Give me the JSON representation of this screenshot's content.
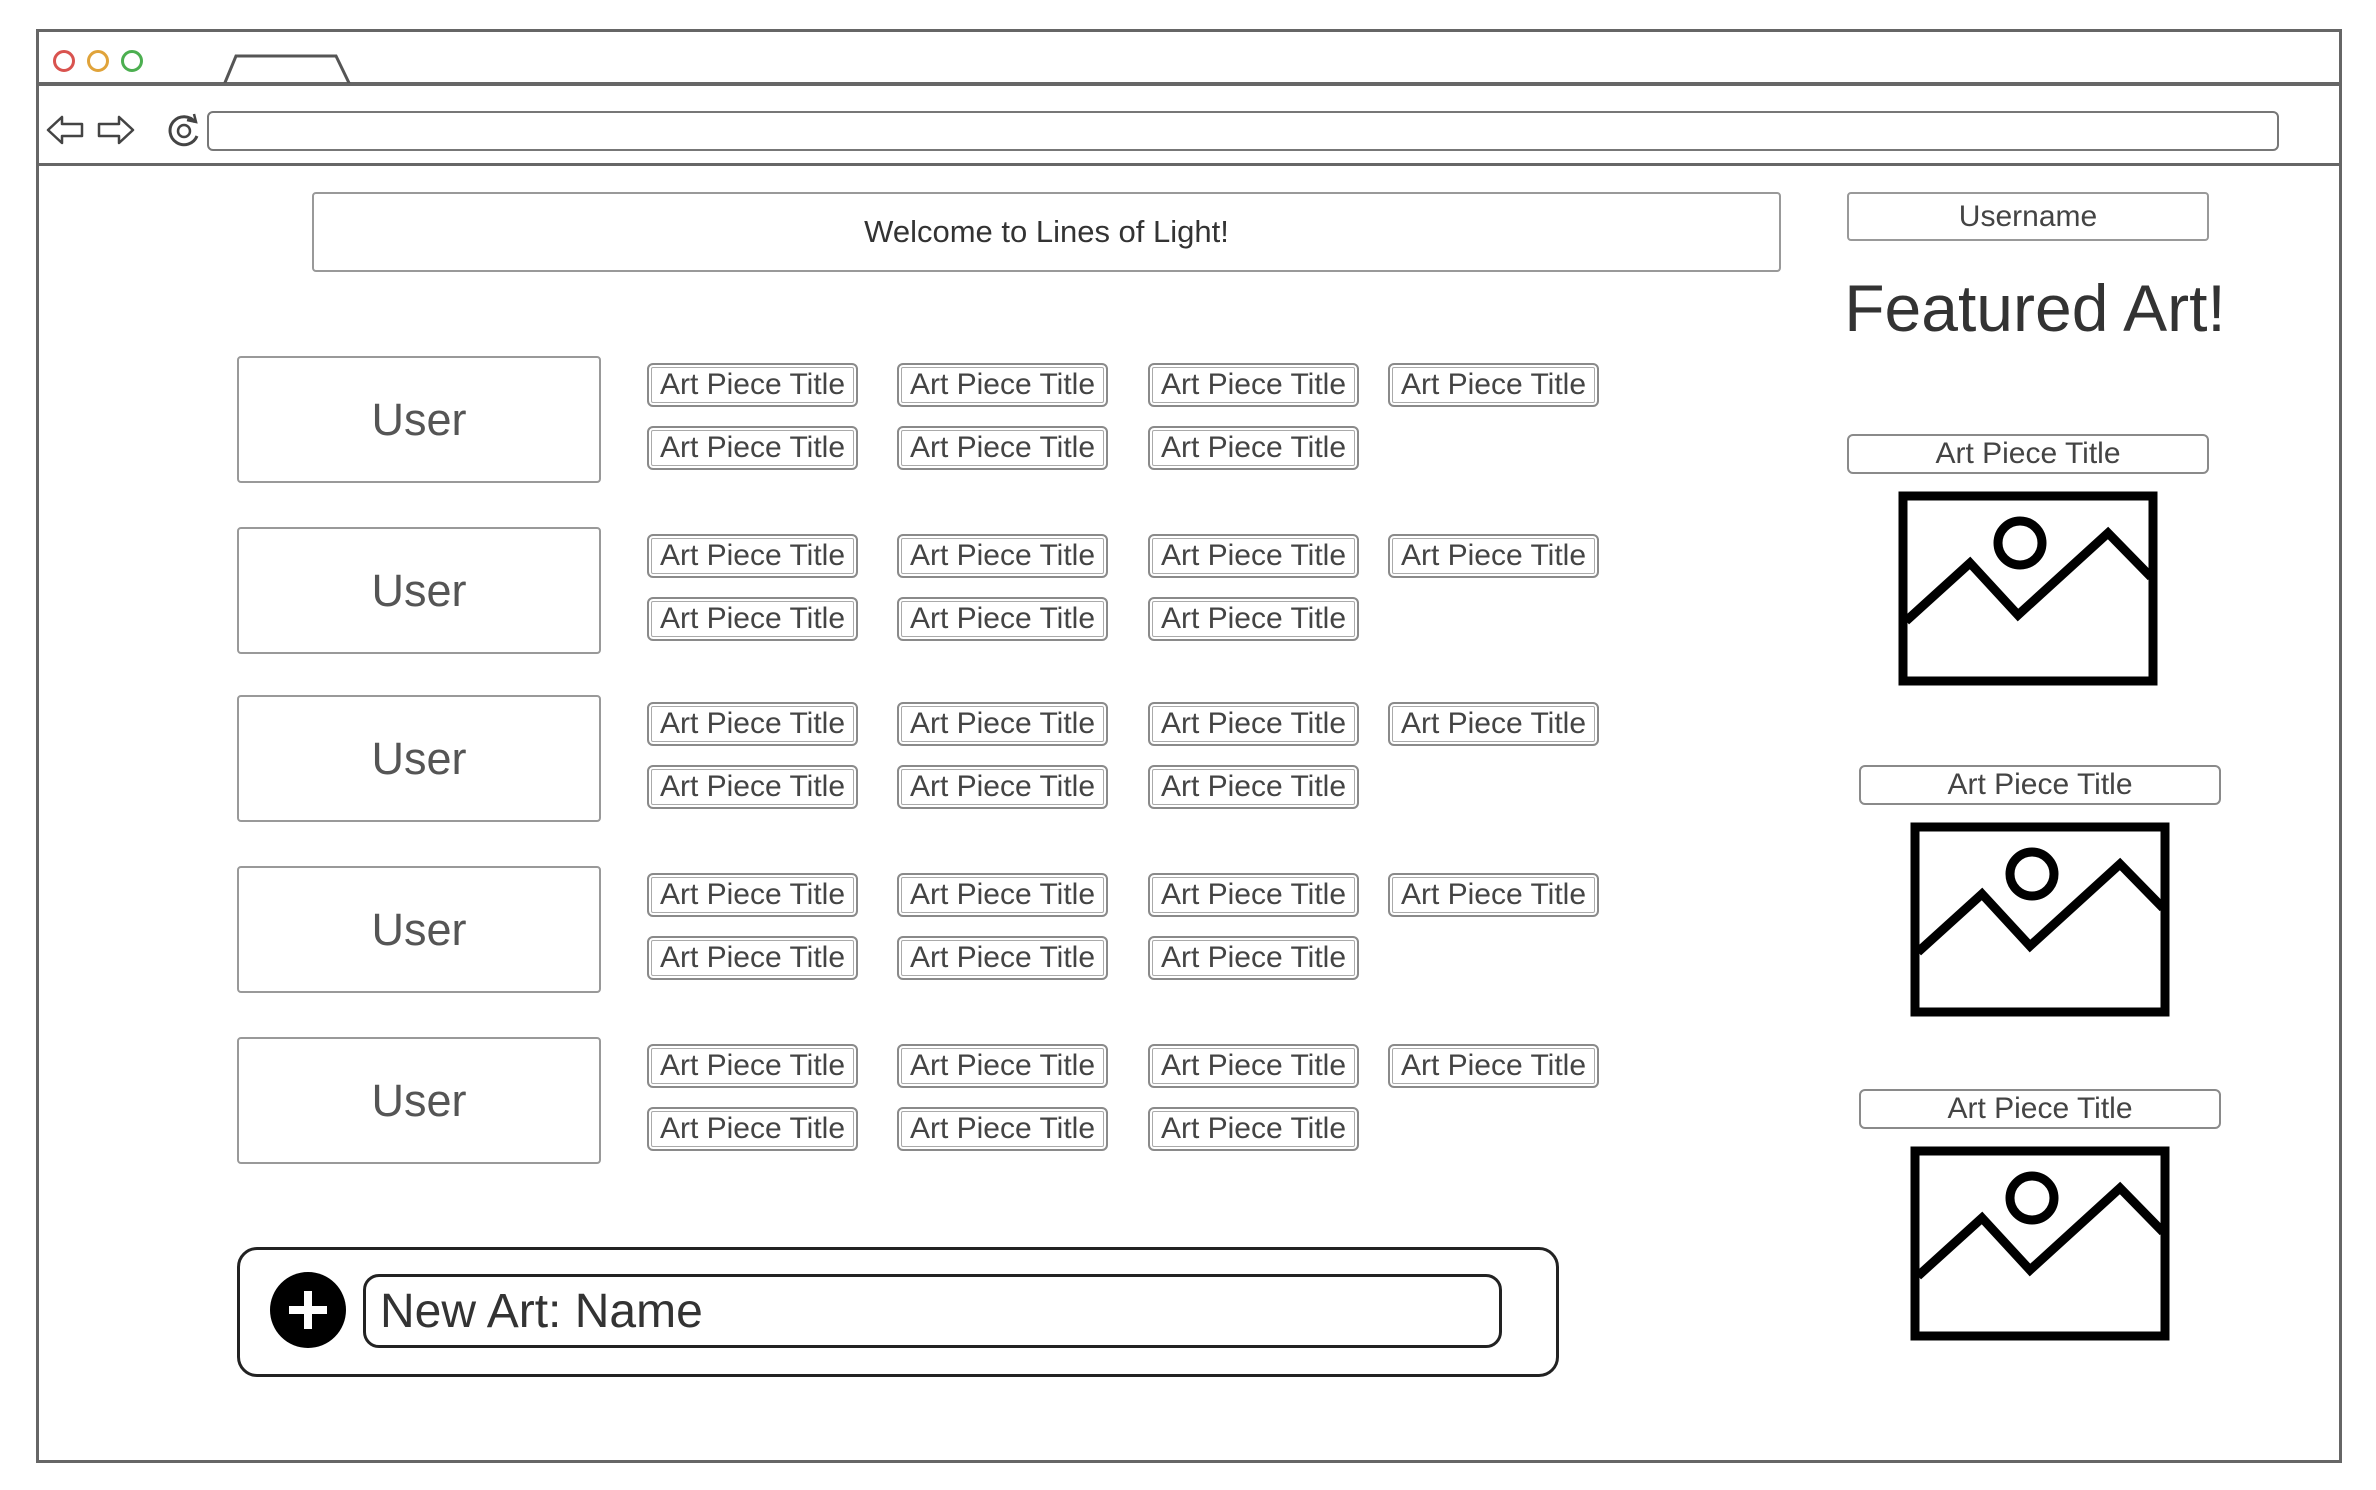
{
  "browser": {
    "window_controls": [
      "close",
      "minimize",
      "maximize"
    ],
    "colors": {
      "close": "#d9534f",
      "minimize": "#e0a33a",
      "maximize": "#4caf50"
    },
    "nav_icons": [
      "back-arrow-icon",
      "forward-arrow-icon",
      "reload-icon"
    ]
  },
  "header": {
    "welcome": "Welcome to Lines of Light!",
    "username": "Username"
  },
  "users": [
    {
      "label": "User",
      "art": [
        "Art Piece Title",
        "Art Piece Title",
        "Art Piece Title",
        "Art Piece Title",
        "Art Piece Title",
        "Art Piece Title",
        "Art Piece Title"
      ]
    },
    {
      "label": "User",
      "art": [
        "Art Piece Title",
        "Art Piece Title",
        "Art Piece Title",
        "Art Piece Title",
        "Art Piece Title",
        "Art Piece Title",
        "Art Piece Title"
      ]
    },
    {
      "label": "User",
      "art": [
        "Art Piece Title",
        "Art Piece Title",
        "Art Piece Title",
        "Art Piece Title",
        "Art Piece Title",
        "Art Piece Title",
        "Art Piece Title"
      ]
    },
    {
      "label": "User",
      "art": [
        "Art Piece Title",
        "Art Piece Title",
        "Art Piece Title",
        "Art Piece Title",
        "Art Piece Title",
        "Art Piece Title",
        "Art Piece Title"
      ]
    },
    {
      "label": "User",
      "art": [
        "Art Piece Title",
        "Art Piece Title",
        "Art Piece Title",
        "Art Piece Title",
        "Art Piece Title",
        "Art Piece Title",
        "Art Piece Title"
      ]
    }
  ],
  "featured": {
    "heading": "Featured Art!",
    "items": [
      {
        "title": "Art Piece Title",
        "icon": "image-placeholder-icon"
      },
      {
        "title": "Art Piece Title",
        "icon": "image-placeholder-icon"
      },
      {
        "title": "Art Piece Title",
        "icon": "image-placeholder-icon"
      }
    ]
  },
  "new_art": {
    "placeholder": "New Art: Name",
    "icon": "plus-circle-icon"
  }
}
